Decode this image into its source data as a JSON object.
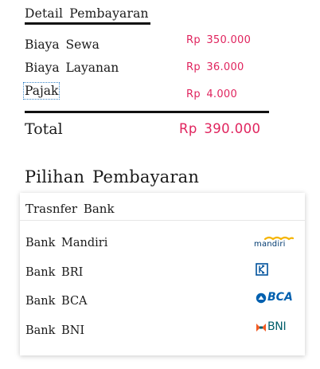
{
  "detail": {
    "title": "Detail Pembayaran",
    "rows": [
      {
        "label": "Biaya Sewa",
        "amount": "Rp 350.000"
      },
      {
        "label": "Biaya Layanan",
        "amount": "Rp 36.000"
      },
      {
        "label": "Pajak",
        "amount": "Rp 4.000"
      }
    ],
    "total_label": "Total",
    "total_amount": "Rp 390.000"
  },
  "payment": {
    "title": "Pilihan Pembayaran",
    "section_header": "Trasnfer Bank",
    "banks": [
      {
        "name": "Bank Mandiri",
        "logo_icon": "mandiri-logo-icon",
        "logo_text": "mandiri"
      },
      {
        "name": "Bank BRI",
        "logo_icon": "bri-logo-icon",
        "logo_text": ""
      },
      {
        "name": "Bank BCA",
        "logo_icon": "bca-logo-icon",
        "logo_text": "BCA"
      },
      {
        "name": "Bank BNI",
        "logo_icon": "bni-logo-icon",
        "logo_text": "BNI"
      }
    ]
  },
  "colors": {
    "amount": "#e0245e",
    "mandiri_blue": "#003a70",
    "mandiri_gold": "#f5b400",
    "bri_blue": "#00529c",
    "bca_blue": "#0060af",
    "bni_orange": "#f15a22",
    "bni_teal": "#005e6a"
  }
}
